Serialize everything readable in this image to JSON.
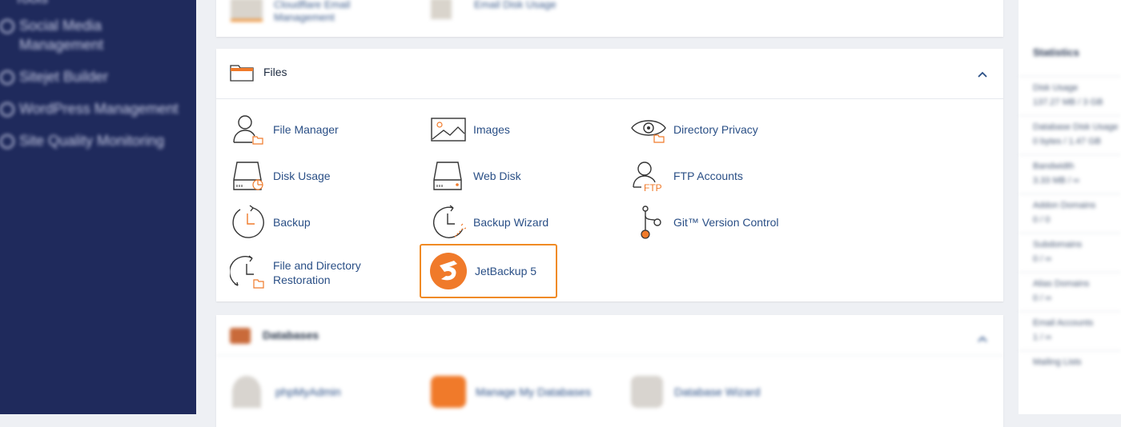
{
  "sidebar": {
    "items": [
      {
        "label": "Social Media Management",
        "icon": "social-icon"
      },
      {
        "label": "Sitejet Builder",
        "icon": "sitejet-icon"
      },
      {
        "label": "WordPress Management",
        "icon": "wordpress-icon"
      },
      {
        "label": "Site Quality Monitoring",
        "icon": "monitoring-icon"
      }
    ]
  },
  "top_card": {
    "items": [
      {
        "label": "Cloudflare Email Management",
        "icon": "email-icon"
      },
      {
        "label": "Email Disk Usage",
        "icon": "email-disk-icon"
      }
    ]
  },
  "files": {
    "title": "Files",
    "items": [
      {
        "label": "File Manager",
        "icon": "file-manager-icon"
      },
      {
        "label": "Images",
        "icon": "images-icon"
      },
      {
        "label": "Directory Privacy",
        "icon": "directory-privacy-icon"
      },
      {
        "label": "Disk Usage",
        "icon": "disk-usage-icon"
      },
      {
        "label": "Web Disk",
        "icon": "web-disk-icon"
      },
      {
        "label": "FTP Accounts",
        "icon": "ftp-accounts-icon"
      },
      {
        "label": "Backup",
        "icon": "backup-icon"
      },
      {
        "label": "Backup Wizard",
        "icon": "backup-wizard-icon"
      },
      {
        "label": "Git™ Version Control",
        "icon": "git-icon"
      },
      {
        "label": "File and Directory Restoration",
        "icon": "restoration-icon"
      },
      {
        "label": "JetBackup 5",
        "icon": "jetbackup-icon"
      }
    ]
  },
  "databases": {
    "title": "Databases",
    "items": [
      {
        "label": "phpMyAdmin",
        "icon": "phpmyadmin-icon"
      },
      {
        "label": "Manage My Databases",
        "icon": "databases-icon"
      },
      {
        "label": "Database Wizard",
        "icon": "database-wizard-icon"
      }
    ]
  },
  "statistics": {
    "title": "Statistics",
    "stats": [
      {
        "label": "Disk Usage",
        "value": "137.27 MB / 3 GB"
      },
      {
        "label": "Database Disk Usage",
        "value": "0 bytes / 1.47 GB"
      },
      {
        "label": "Bandwidth",
        "value": "3.33 MB / ∞"
      },
      {
        "label": "Addon Domains",
        "value": "0 / 0"
      },
      {
        "label": "Subdomains",
        "value": "0 / ∞"
      },
      {
        "label": "Alias Domains",
        "value": "0 / ∞"
      },
      {
        "label": "Email Accounts",
        "value": "1 / ∞"
      },
      {
        "label": "Mailing Lists",
        "value": ""
      }
    ]
  },
  "colors": {
    "accent": "#f08a24",
    "sidebar_bg": "#1f2a5c",
    "link": "#2a4f86"
  }
}
